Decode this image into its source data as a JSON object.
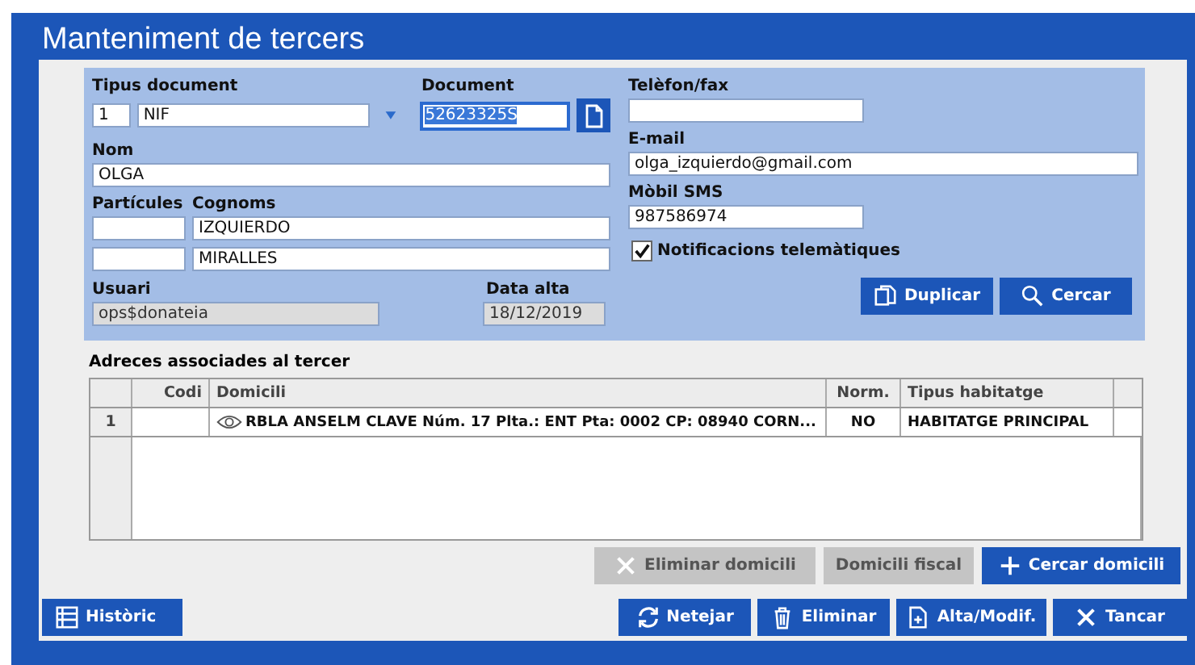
{
  "window": {
    "title": "Manteniment de tercers"
  },
  "form": {
    "tipus_document": {
      "label": "Tipus document",
      "code": "1",
      "value": "NIF"
    },
    "document": {
      "label": "Document",
      "value": "52623325S",
      "text_selected": true
    },
    "nom": {
      "label": "Nom",
      "value": "OLGA"
    },
    "particules": {
      "label": "Partícules"
    },
    "cognoms": {
      "label": "Cognoms",
      "values": [
        "IZQUIERDO",
        "MIRALLES"
      ]
    },
    "usuari": {
      "label": "Usuari",
      "value": "ops$donateia",
      "disabled": true
    },
    "data_alta": {
      "label": "Data alta",
      "value": "18/12/2019",
      "disabled": true
    },
    "telefon": {
      "label": "Telèfon/fax"
    },
    "email": {
      "label": "E-mail",
      "value": "olga_izquierdo@gmail.com"
    },
    "mobil": {
      "label": "Mòbil SMS",
      "value": "987586974"
    },
    "notificacions": {
      "label": "Notificacions telemàtiques",
      "checked": true
    },
    "buttons": [
      {
        "label": "Duplicar",
        "kind": "copy"
      },
      {
        "label": "Cercar",
        "kind": "search"
      }
    ]
  },
  "addresses": {
    "title": "Adreces associades al tercer",
    "columns": [
      "Codi",
      "Domicili",
      "Norm.",
      "Tipus habitatge"
    ],
    "rows": [
      {
        "index": "1",
        "domicili": "RBLA ANSELM CLAVE Núm. 17 Plta.: ENT Pta: 0002 CP: 08940 CORN...",
        "norm": "NO",
        "tipus": "HABITATGE PRINCIPAL"
      }
    ],
    "buttons": [
      {
        "label": "Eliminar domicili",
        "kind": "remove",
        "disabled": true
      },
      {
        "label": "Domicili fiscal",
        "kind": "text",
        "disabled": true
      },
      {
        "label": "Cercar domicili",
        "kind": "add",
        "disabled": false
      }
    ]
  },
  "left_buttons": [
    {
      "label": "Històric",
      "kind": "history"
    }
  ],
  "right_buttons": [
    {
      "label": "Netejar",
      "kind": "reset"
    },
    {
      "label": "Eliminar",
      "kind": "delete"
    },
    {
      "label": "Alta/Modif.",
      "kind": "save"
    },
    {
      "label": "Tancar",
      "kind": "close"
    }
  ]
}
